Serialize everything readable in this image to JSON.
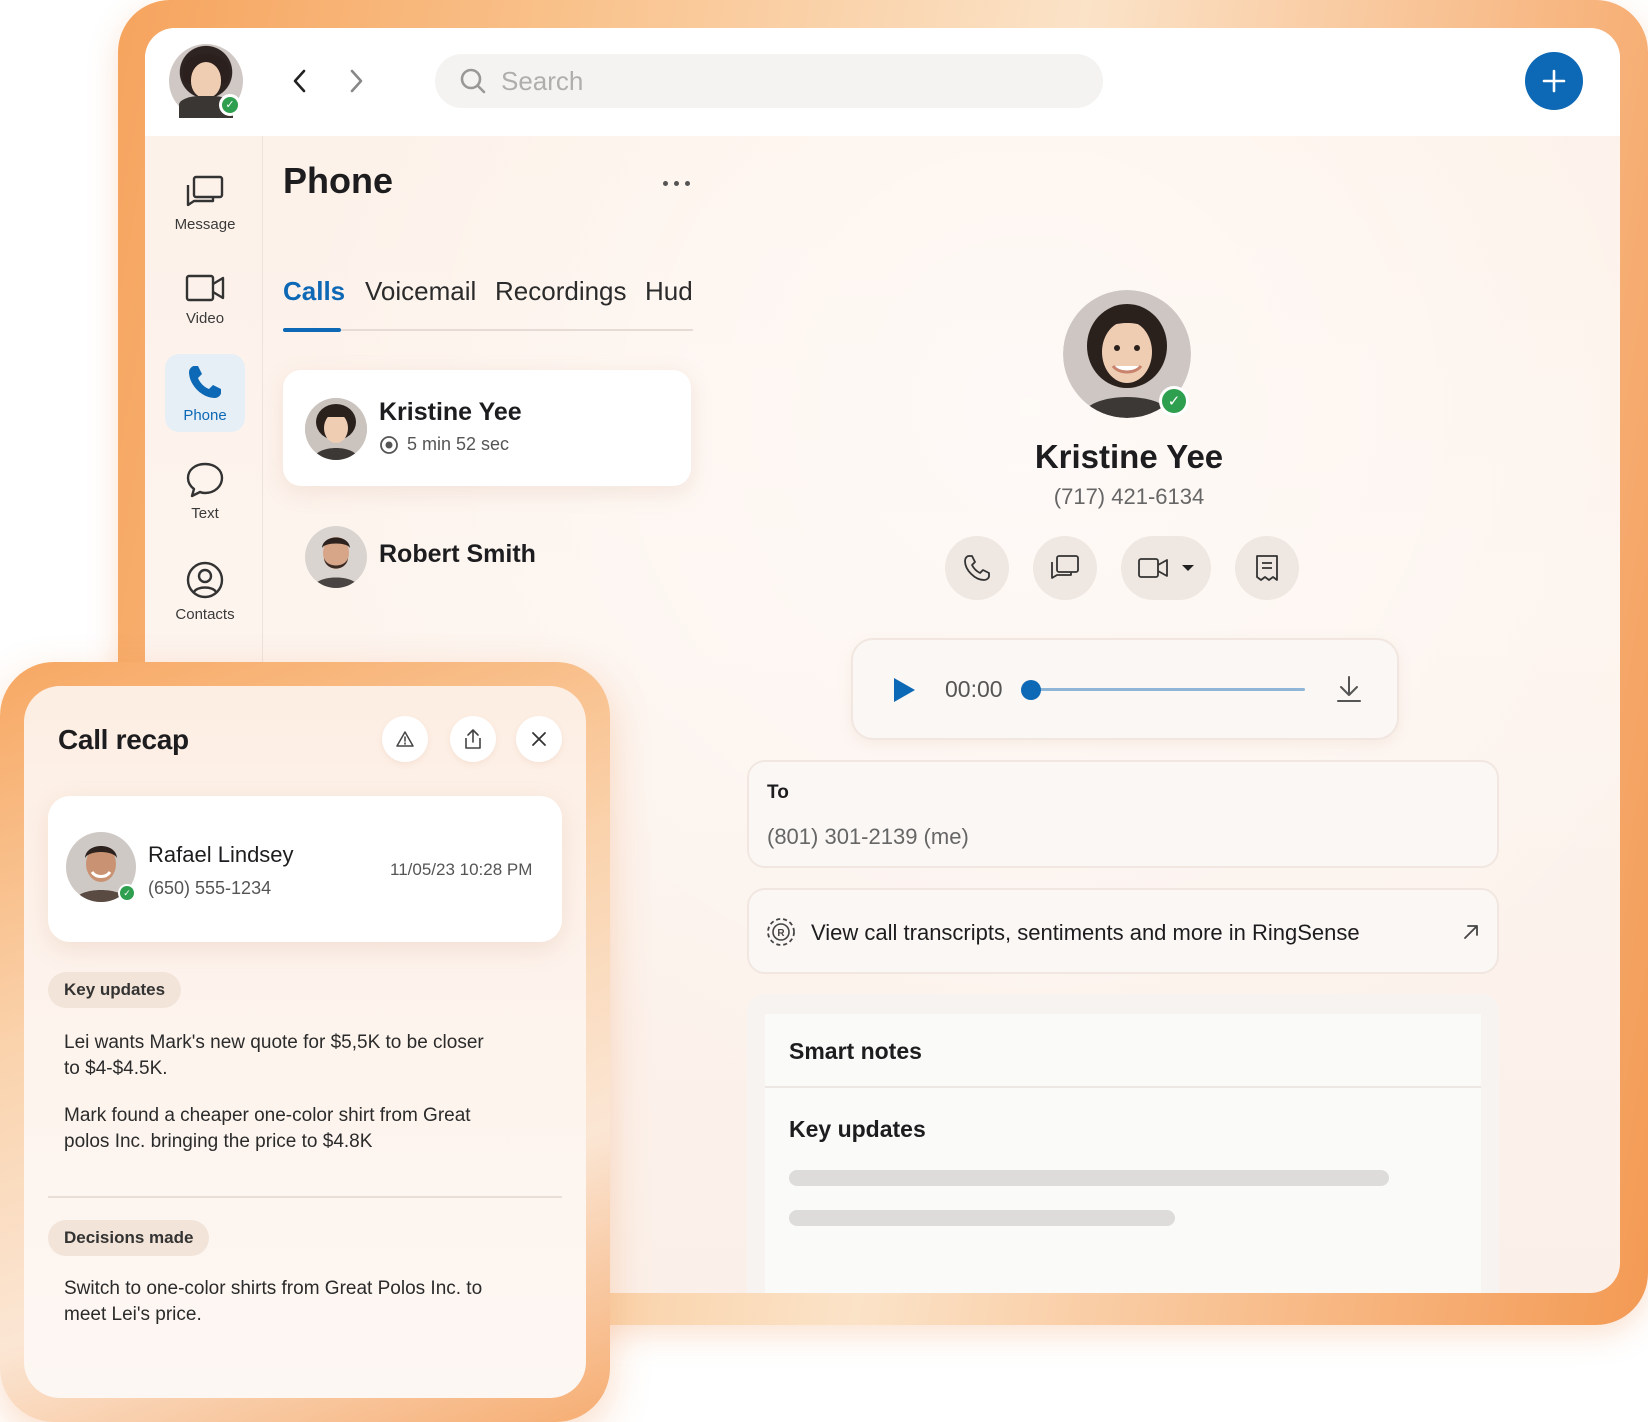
{
  "app": {
    "search_placeholder": "Search",
    "accent_color": "#0d68b5",
    "online_status_color": "#2e9e4f"
  },
  "sidebar": {
    "items": [
      {
        "label": "Message",
        "icon": "message-icon"
      },
      {
        "label": "Video",
        "icon": "video-icon"
      },
      {
        "label": "Phone",
        "icon": "phone-icon",
        "active": true
      },
      {
        "label": "Text",
        "icon": "text-bubble-icon"
      },
      {
        "label": "Contacts",
        "icon": "contacts-icon"
      }
    ]
  },
  "phone_pane": {
    "title": "Phone",
    "tabs": [
      {
        "label": "Calls",
        "active": true
      },
      {
        "label": "Voicemail"
      },
      {
        "label": "Recordings"
      },
      {
        "label": "Hud"
      }
    ],
    "calls": [
      {
        "name": "Kristine Yee",
        "duration": "5 min 52 sec",
        "selected": true
      },
      {
        "name": "Robert Smith"
      }
    ]
  },
  "detail": {
    "name": "Kristine Yee",
    "phone": "(717) 421-6134",
    "actions": [
      "phone-icon",
      "message-icon",
      "video-icon",
      "notes-icon"
    ],
    "player": {
      "time": "00:00",
      "progress": 0
    },
    "to_label": "To",
    "to_value": "(801) 301-2139 (me)",
    "ringsense_text": "View call transcripts, sentiments and more in RingSense",
    "smart_notes_title": "Smart notes",
    "key_updates_title": "Key updates"
  },
  "recap": {
    "title": "Call recap",
    "contact": {
      "name": "Rafael Lindsey",
      "phone": "(650) 555-1234",
      "datetime": "11/05/23 10:28 PM"
    },
    "key_updates_label": "Key updates",
    "key_updates": [
      "Lei wants Mark's new quote for $5,5K to be closer to $4-$4.5K.",
      "Mark found a cheaper one-color shirt from Great polos Inc. bringing the price to $4.8K"
    ],
    "decisions_label": "Decisions made",
    "decisions": [
      "Switch to one-color shirts from Great Polos Inc. to meet Lei's price."
    ]
  }
}
